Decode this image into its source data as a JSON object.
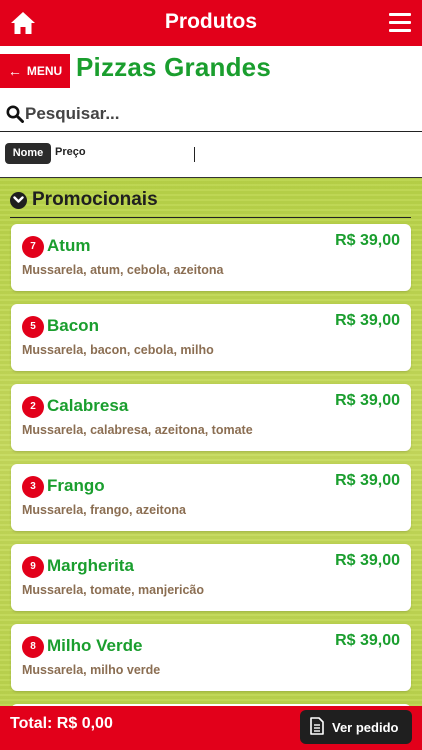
{
  "header": {
    "title": "Produtos",
    "home_icon": "home-icon",
    "menu_icon": "hamburger-icon"
  },
  "menu_button": {
    "label": "MENU",
    "icon": "arrow-left-icon"
  },
  "page_title": "Pizzas Grandes",
  "search": {
    "placeholder": "Pesquisar...",
    "value": ""
  },
  "sort": {
    "options": [
      "Nome",
      "Preço"
    ],
    "selected": "Nome"
  },
  "section": {
    "title": "Promocionais",
    "icon": "chevron-down-circle-icon"
  },
  "products": [
    {
      "num": "7",
      "name": "Atum",
      "price": "R$ 39,00",
      "desc": "Mussarela, atum, cebola, azeitona"
    },
    {
      "num": "5",
      "name": "Bacon",
      "price": "R$ 39,00",
      "desc": "Mussarela, bacon, cebola, milho"
    },
    {
      "num": "2",
      "name": "Calabresa",
      "price": "R$ 39,00",
      "desc": "Mussarela, calabresa, azeitona, tomate"
    },
    {
      "num": "3",
      "name": "Frango",
      "price": "R$ 39,00",
      "desc": "Mussarela, frango, azeitona"
    },
    {
      "num": "9",
      "name": "Margherita",
      "price": "R$ 39,00",
      "desc": "Mussarela, tomate, manjericão"
    },
    {
      "num": "8",
      "name": "Milho Verde",
      "price": "R$ 39,00",
      "desc": "Mussarela, milho verde"
    }
  ],
  "footer": {
    "total": "Total: R$ 0,00",
    "button_label": "Ver pedido",
    "button_icon": "document-icon"
  },
  "colors": {
    "brand_red": "#e2001a",
    "green": "#1a9e2e",
    "dark": "#1f1f1f",
    "desc_brown": "#8b6e52"
  }
}
